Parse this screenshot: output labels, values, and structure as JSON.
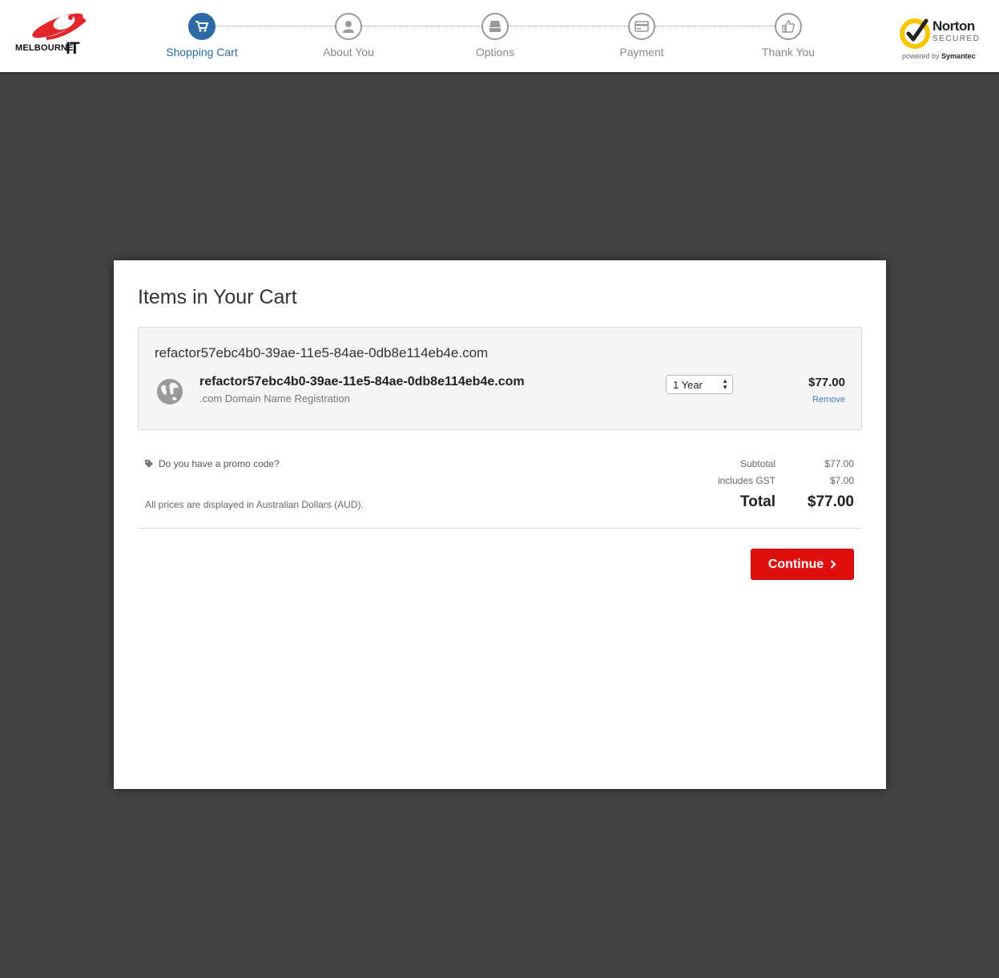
{
  "brand": {
    "name": "MELBOURNE",
    "suffix": "IT"
  },
  "steps": [
    {
      "label": "Shopping Cart",
      "icon": "cart-icon",
      "active": true
    },
    {
      "label": "About You",
      "icon": "user-icon",
      "active": false
    },
    {
      "label": "Options",
      "icon": "options-icon",
      "active": false
    },
    {
      "label": "Payment",
      "icon": "credit-card-icon",
      "active": false
    },
    {
      "label": "Thank You",
      "icon": "thumbs-up-icon",
      "active": false
    }
  ],
  "norton": {
    "title": "Norton",
    "secured": "SECURED",
    "powered_prefix": "powered by",
    "powered_brand": "Symantec"
  },
  "cart": {
    "title": "Items in Your Cart",
    "domain_heading": "refactor57ebc4b0-39ae-11e5-84ae-0db8e114eb4e.com",
    "item": {
      "name": "refactor57ebc4b0-39ae-11e5-84ae-0db8e114eb4e.com",
      "description": ".com Domain Name Registration",
      "term": "1 Year",
      "price": "$77.00",
      "remove_label": "Remove"
    },
    "promo_label": "Do you have a promo code?",
    "currency_note": "All prices are displayed in Australian Dollars (AUD).",
    "subtotal_label": "Subtotal",
    "subtotal_value": "$77.00",
    "gst_label": "includes GST",
    "gst_value": "$7.00",
    "total_label": "Total",
    "total_value": "$77.00",
    "continue_label": "Continue"
  },
  "colors": {
    "accent": "#2d6aa6",
    "cta": "#e00f0f",
    "backdrop": "#444444"
  }
}
